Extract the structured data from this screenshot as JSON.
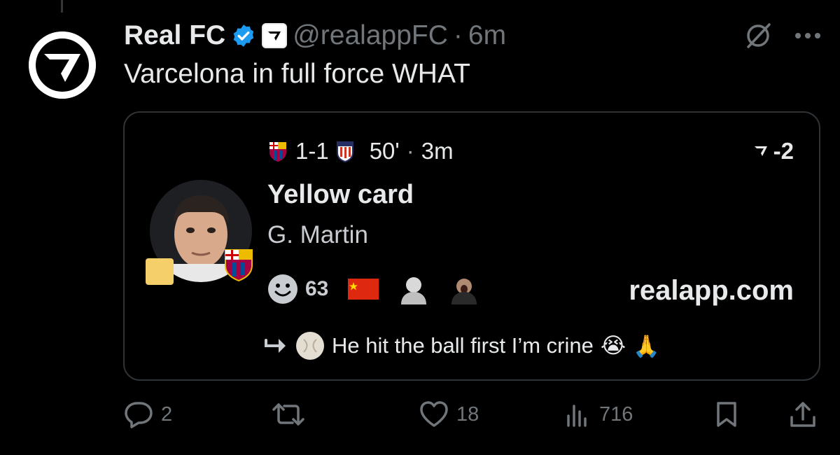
{
  "tweet": {
    "author_name": "Real FC",
    "handle": "@realappFC",
    "separator": "·",
    "time": "6m",
    "text": "Varcelona in full force WHAT"
  },
  "card": {
    "home_score": "1-1",
    "match_time": "50'",
    "separator": "·",
    "age": "3m",
    "delta": "-2",
    "event_title": "Yellow card",
    "player": "G. Martin",
    "reaction_count": "63",
    "site": "realapp.com",
    "reply_text": "He hit the ball first I’m crine",
    "reply_emojis": [
      "😭",
      "🙏"
    ]
  },
  "actions": {
    "replies": "2",
    "likes": "18",
    "views": "716"
  },
  "colors": {
    "background": "#000000",
    "muted": "#71767b",
    "verified_blue": "#1d9bf0",
    "yellow_card": "#f4cf6a"
  },
  "icons": [
    "verified-badge-icon",
    "grok-icon",
    "more-icon",
    "reply-icon",
    "retweet-icon",
    "like-icon",
    "views-icon",
    "bookmark-icon",
    "share-icon",
    "smiley-icon",
    "reply-arrow-icon"
  ]
}
